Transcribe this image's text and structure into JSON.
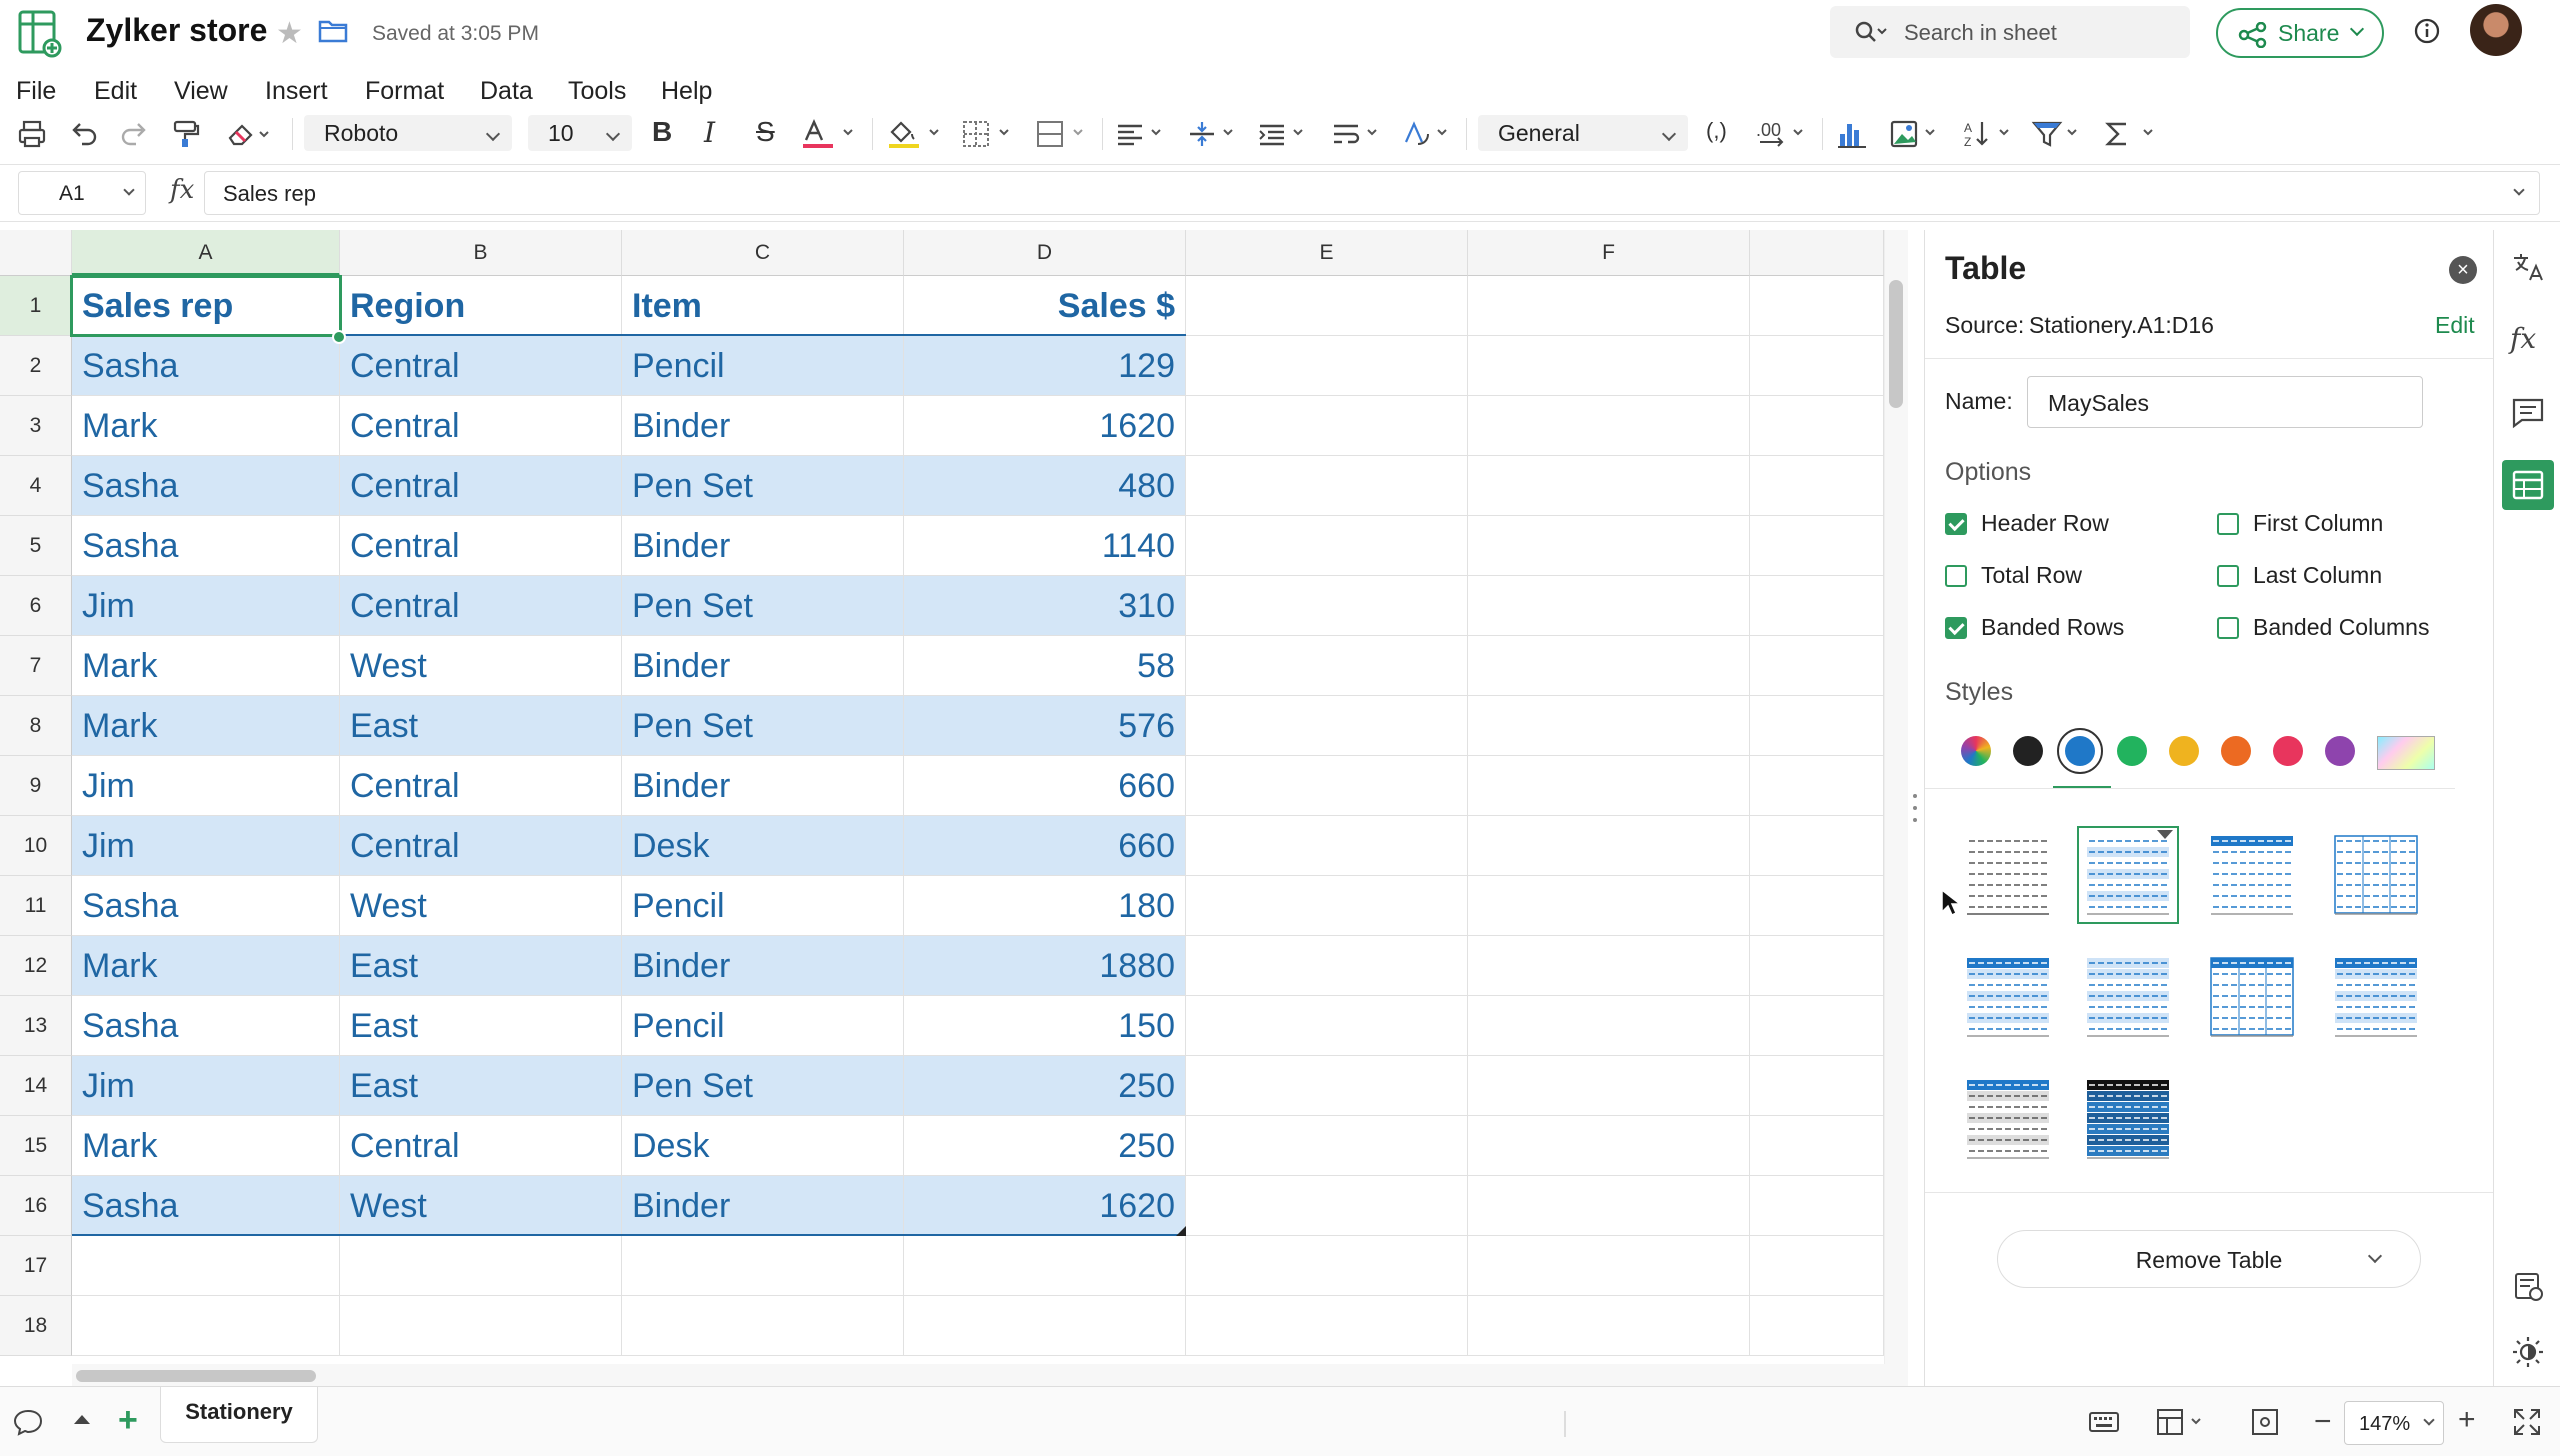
{
  "header": {
    "title": "Zylker store",
    "saved_status": "Saved at 3:05 PM",
    "search_placeholder": "Search in sheet",
    "share_label": "Share"
  },
  "menu": [
    "File",
    "Edit",
    "View",
    "Insert",
    "Format",
    "Data",
    "Tools",
    "Help"
  ],
  "toolbar": {
    "font": "Roboto",
    "size": "10",
    "number_format": "General",
    "decimals_label": ".00"
  },
  "formula_bar": {
    "cell_ref": "A1",
    "fx_label": "fx",
    "content": "Sales rep"
  },
  "grid": {
    "columns": [
      "A",
      "B",
      "C",
      "D",
      "E",
      "F"
    ],
    "rows": [
      "1",
      "2",
      "3",
      "4",
      "5",
      "6",
      "7",
      "8",
      "9",
      "10",
      "11",
      "12",
      "13",
      "14",
      "15",
      "16",
      "17",
      "18"
    ],
    "headers": [
      "Sales rep",
      "Region",
      "Item",
      "Sales $"
    ],
    "data": [
      [
        "Sasha",
        "Central",
        "Pencil",
        "129"
      ],
      [
        "Mark",
        "Central",
        "Binder",
        "1620"
      ],
      [
        "Sasha",
        "Central",
        "Pen Set",
        "480"
      ],
      [
        "Sasha",
        "Central",
        "Binder",
        "1140"
      ],
      [
        "Jim",
        "Central",
        "Pen Set",
        "310"
      ],
      [
        "Mark",
        "West",
        "Binder",
        "58"
      ],
      [
        "Mark",
        "East",
        "Pen Set",
        "576"
      ],
      [
        "Jim",
        "Central",
        "Binder",
        "660"
      ],
      [
        "Jim",
        "Central",
        "Desk",
        "660"
      ],
      [
        "Sasha",
        "West",
        "Pencil",
        "180"
      ],
      [
        "Mark",
        "East",
        "Binder",
        "1880"
      ],
      [
        "Sasha",
        "East",
        "Pencil",
        "150"
      ],
      [
        "Jim",
        "East",
        "Pen Set",
        "250"
      ],
      [
        "Mark",
        "Central",
        "Desk",
        "250"
      ],
      [
        "Sasha",
        "West",
        "Binder",
        "1620"
      ]
    ],
    "band_color": "#d4e6f7",
    "text_color": "#1f66a3"
  },
  "panel": {
    "title": "Table",
    "source_label": "Source:",
    "source_value": "Stationery.A1:D16",
    "edit_label": "Edit",
    "name_label": "Name:",
    "name_value": "MaySales",
    "options_label": "Options",
    "options": [
      {
        "label": "Header Row",
        "checked": true
      },
      {
        "label": "First Column",
        "checked": false
      },
      {
        "label": "Total Row",
        "checked": false
      },
      {
        "label": "Last Column",
        "checked": false
      },
      {
        "label": "Banded Rows",
        "checked": true
      },
      {
        "label": "Banded Columns",
        "checked": false
      }
    ],
    "styles_label": "Styles",
    "style_colors": [
      "#222222",
      "#1f78c8",
      "#22b35e",
      "#efb31f",
      "#ec6a22",
      "#e8355d",
      "#8e44ad"
    ],
    "remove_label": "Remove Table",
    "accent": "#2e9a5e"
  },
  "sheet": {
    "tab": "Stationery",
    "zoom": "147%"
  }
}
